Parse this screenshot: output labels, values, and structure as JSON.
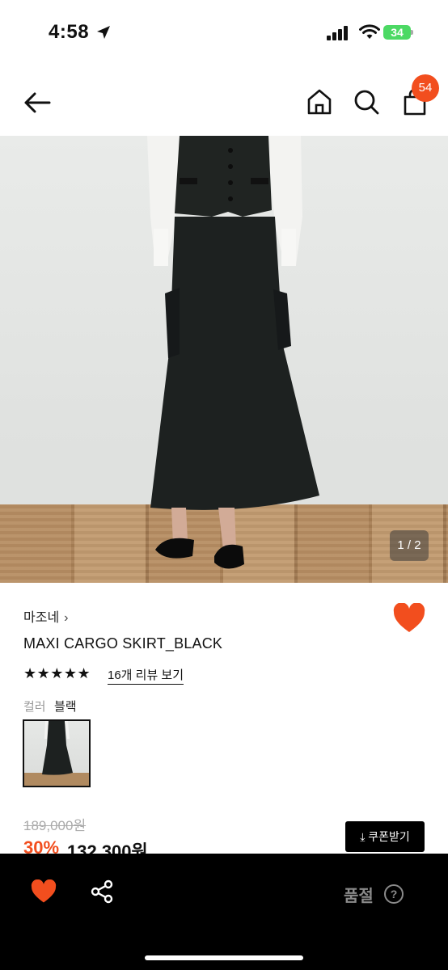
{
  "status": {
    "time": "4:58",
    "battery": "34"
  },
  "nav": {
    "cart_count": "54",
    "icons": [
      "back-arrow-icon",
      "home-icon",
      "search-icon",
      "shopping-bag-icon"
    ]
  },
  "gallery": {
    "counter": "1 / 2"
  },
  "product": {
    "brand": "마조네",
    "brand_chevron": "›",
    "title": "MAXI CARGO SKIRT_BLACK",
    "stars": "★★★★★",
    "rating": 5,
    "reviews_link": "16개 리뷰 보기",
    "color_label": "컬러",
    "color_value": "블랙",
    "original_price": "189,000원",
    "discount": "30%",
    "price": "132,300원",
    "coupon_button": "⤓ 쿠폰받기",
    "liked": true
  },
  "bottom_bar": {
    "soldout_label": "품절",
    "help_icon": "?"
  },
  "colors": {
    "accent": "#f24e1e",
    "bar": "#000000",
    "disabled_text": "#8a8a8a"
  }
}
